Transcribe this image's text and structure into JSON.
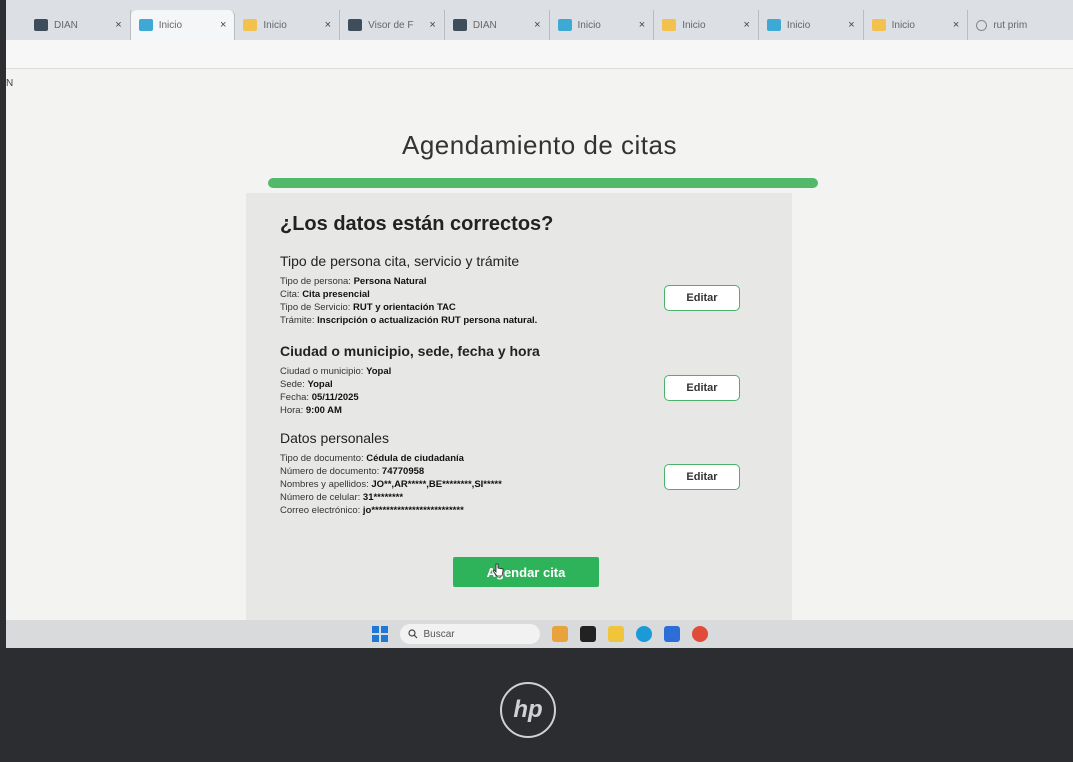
{
  "browser": {
    "tabs": [
      {
        "label": "DIAN",
        "icon": "dian-icon",
        "active": false
      },
      {
        "label": "Inicio",
        "icon": "dian-icon",
        "active": true
      },
      {
        "label": "Inicio",
        "icon": "folder-icon",
        "active": false
      },
      {
        "label": "Visor de F",
        "icon": "dian-icon",
        "active": false
      },
      {
        "label": "DIAN",
        "icon": "dian-icon",
        "active": false
      },
      {
        "label": "Inicio",
        "icon": "dian-icon",
        "active": false
      },
      {
        "label": "Inicio",
        "icon": "folder-icon",
        "active": false
      },
      {
        "label": "Inicio",
        "icon": "dian-icon",
        "active": false
      },
      {
        "label": "Inicio",
        "icon": "folder-icon",
        "active": false
      },
      {
        "label": "rut prim",
        "icon": "search-icon",
        "active": false
      }
    ],
    "tab_close": "×"
  },
  "page": {
    "side_mark": "N",
    "title": "Agendamiento de citas",
    "progress": 1.0,
    "question": "¿Los datos están correctos?",
    "sections": [
      {
        "title": "Tipo de persona cita, servicio y trámite",
        "rows": [
          {
            "label": "Tipo de persona:",
            "value": "Persona Natural"
          },
          {
            "label": "Cita:",
            "value": "Cita presencial"
          },
          {
            "label": "Tipo de Servicio:",
            "value": "RUT y orientación TAC"
          },
          {
            "label": "Trámite:",
            "value": "Inscripción o actualización RUT persona natural."
          }
        ],
        "edit_label": "Editar"
      },
      {
        "title": "Ciudad o municipio, sede, fecha y hora",
        "rows": [
          {
            "label": "Ciudad o municipio:",
            "value": "Yopal"
          },
          {
            "label": "Sede:",
            "value": "Yopal"
          },
          {
            "label": "Fecha:",
            "value": "05/11/2025"
          },
          {
            "label": "Hora:",
            "value": "9:00 AM"
          }
        ],
        "edit_label": "Editar"
      },
      {
        "title": "Datos personales",
        "rows": [
          {
            "label": "Tipo de documento:",
            "value": "Cédula de ciudadanía"
          },
          {
            "label": "Número de documento:",
            "value": "74770958"
          },
          {
            "label": "Nombres y apellidos:",
            "value": "JO**,AR*****,BE********,SI*****"
          },
          {
            "label": "Número de celular:",
            "value": "31********"
          },
          {
            "label": "Correo electrónico:",
            "value": "jo*************************"
          }
        ],
        "edit_label": "Editar"
      }
    ],
    "submit_label": "Agendar cita"
  },
  "taskbar": {
    "search_placeholder": "Buscar",
    "apps": [
      "widgets-icon",
      "task-view-icon",
      "file-explorer-icon",
      "edge-icon",
      "store-icon",
      "chrome-icon"
    ]
  },
  "monitor": {
    "brand": "hp"
  },
  "colors": {
    "accent": "#2fb35a",
    "progress": "#52b96a",
    "edit_border": "#4cb068"
  }
}
